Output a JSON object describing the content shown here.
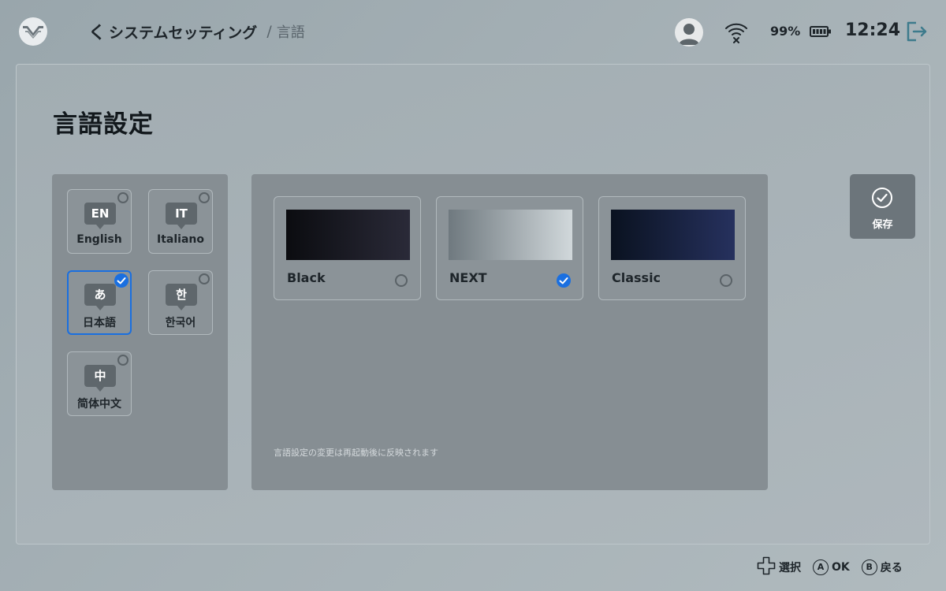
{
  "header": {
    "logo_icon": "console-logo-icon",
    "breadcrumb": {
      "back_chevron": "く",
      "back_label": "システムセッティング",
      "separator": "/",
      "current": "言語"
    },
    "status": {
      "avatar_icon": "user-avatar-icon",
      "wifi_icon": "wifi-disconnected-icon",
      "battery_percent": "99%",
      "battery_icon": "battery-icon",
      "time": "12:24",
      "exit_icon": "exit-icon"
    }
  },
  "page": {
    "title": "言語設定"
  },
  "languages": {
    "items": [
      {
        "badge": "EN",
        "label": "English",
        "selected": false
      },
      {
        "badge": "IT",
        "label": "Italiano",
        "selected": false
      },
      {
        "badge": "あ",
        "label": "日本語",
        "selected": true
      },
      {
        "badge": "한",
        "label": "한국어",
        "selected": false
      },
      {
        "badge": "中",
        "label": "简体中文",
        "selected": false
      }
    ]
  },
  "themes": {
    "items": [
      {
        "name": "Black",
        "selected": false,
        "gradient_start": "#0b0c10",
        "gradient_end": "#2a2a38"
      },
      {
        "name": "NEXT",
        "selected": true,
        "gradient_start": "#6f797f",
        "gradient_end": "#d1d8db"
      },
      {
        "name": "Classic",
        "selected": false,
        "gradient_start": "#0a1220",
        "gradient_end": "#26315e"
      }
    ],
    "note": "言語設定の変更は再起動後に反映されます"
  },
  "actions": {
    "save_icon": "check-circle-icon",
    "save_label": "保存"
  },
  "footer": {
    "hints": [
      {
        "icon": "dpad-icon",
        "label": "選択"
      },
      {
        "icon": "a-button-icon",
        "button": "A",
        "label": "OK"
      },
      {
        "icon": "b-button-icon",
        "button": "B",
        "label": "戻る"
      }
    ]
  },
  "colors": {
    "accent": "#1a6fe0",
    "panel": "#868e93",
    "background": "#a6b1b6"
  }
}
